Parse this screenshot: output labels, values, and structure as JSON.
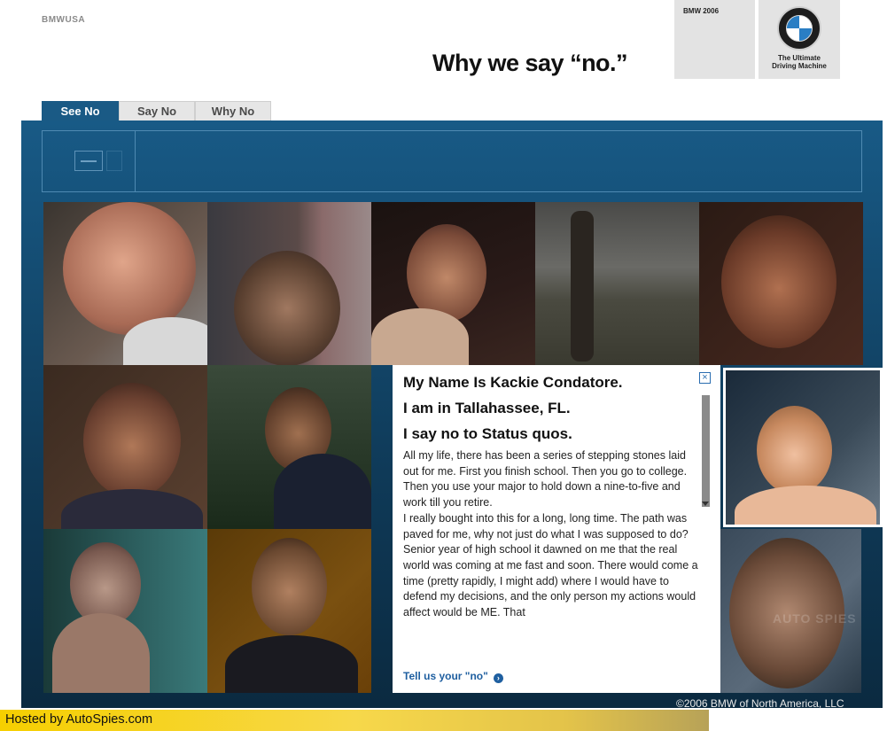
{
  "header": {
    "site_name": "BMWUSA",
    "headline": "Why we say “no.”",
    "brand_year": "BMW 2006",
    "logo_text": "B M W",
    "tagline_line1": "The Ultimate",
    "tagline_line2": "Driving Machine"
  },
  "tabs": [
    {
      "label": "See No",
      "active": true
    },
    {
      "label": "Say No",
      "active": false
    },
    {
      "label": "Why No",
      "active": false
    }
  ],
  "profile": {
    "line1": "My Name Is Kackie Condatore.",
    "line2": "I am in Tallahassee, FL.",
    "line3": "I say no to Status quos.",
    "paragraph1": "All my life, there has been a series of stepping stones laid out for me. First you finish school. Then you go to college. Then you use your major to hold down a nine-to-five and work till you retire.",
    "paragraph2": "I really bought into this for a long, long time. The path was paved for me, why not just do what I was supposed to do?",
    "paragraph3": "Senior year of high school it dawned on me that the real world was coming at me fast and soon. There would come a time (pretty rapidly, I might add) where I would have to defend my decisions, and the only person my actions would affect would be ME. That",
    "close_symbol": "×",
    "cta_label": "Tell us your \"no\"",
    "cta_arrow": "›"
  },
  "footer": {
    "copyright": "©2006 BMW of North America, LLC",
    "hosted_by": "Hosted by AutoSpies.com",
    "watermark": "AUTO SPIES"
  },
  "colors": {
    "stage_blue": "#185a86",
    "tab_active": "#1a5a85",
    "link_blue": "#1f5fa0",
    "host_yellow": "#f6cf00"
  }
}
